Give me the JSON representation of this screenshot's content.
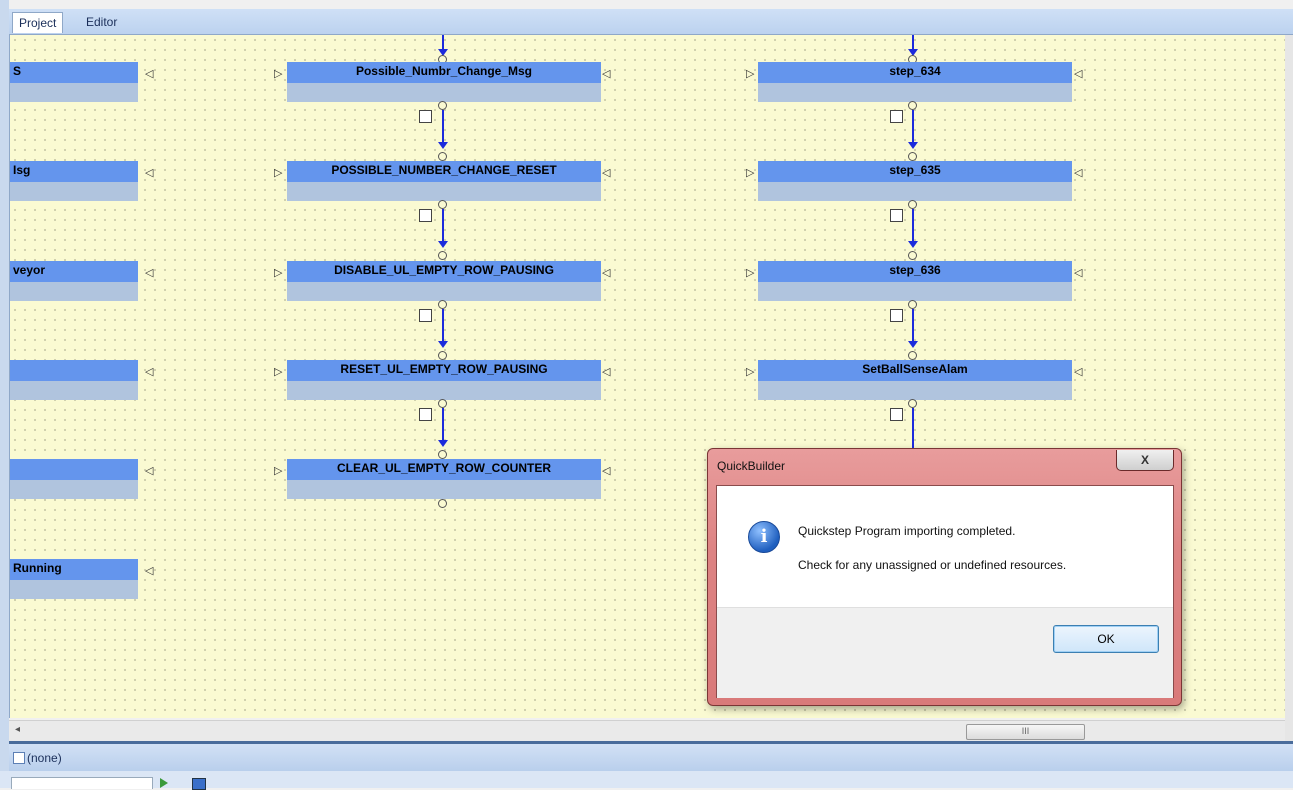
{
  "tabs": [
    {
      "label": "Project"
    },
    {
      "label": "Editor"
    }
  ],
  "left_steps": [
    {
      "label": "S"
    },
    {
      "label": "Isg"
    },
    {
      "label": "veyor"
    },
    {
      "label": ""
    },
    {
      "label": ""
    },
    {
      "label": "Running"
    }
  ],
  "middle_steps": [
    {
      "label": "Possible_Numbr_Change_Msg"
    },
    {
      "label": "POSSIBLE_NUMBER_CHANGE_RESET"
    },
    {
      "label": "DISABLE_UL_EMPTY_ROW_PAUSING"
    },
    {
      "label": "RESET_UL_EMPTY_ROW_PAUSING"
    },
    {
      "label": "CLEAR_UL_EMPTY_ROW_COUNTER"
    }
  ],
  "right_steps": [
    {
      "label": "step_634"
    },
    {
      "label": "step_635"
    },
    {
      "label": "step_636"
    },
    {
      "label": "SetBallSenseAlam"
    }
  ],
  "scrollbar": {
    "thumb_grip": "III",
    "left_arrow": "◂"
  },
  "status": {
    "text": "(none)"
  },
  "dialog": {
    "title": "QuickBuilder",
    "close_label": "X",
    "info_glyph": "i",
    "message_line1": "Quickstep Program importing completed.",
    "message_line2": "Check for any unassigned or undefined resources.",
    "ok_label": "OK"
  },
  "colors": {
    "canvas": "#fafad2",
    "step_header": "#6495ed",
    "step_body": "#b0c4de",
    "connector": "#1c2bdc",
    "dialog_frame": "#dd8383"
  }
}
